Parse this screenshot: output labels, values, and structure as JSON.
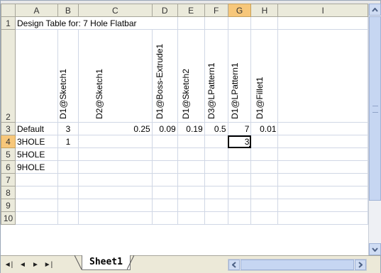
{
  "columns": [
    "A",
    "B",
    "C",
    "D",
    "E",
    "F",
    "G",
    "H",
    "I"
  ],
  "selected_column": "G",
  "rows": [
    {
      "num": "1",
      "cells": {
        "A": "Design Table for: 7 Hole Flatbar"
      }
    },
    {
      "num": "2",
      "headers": {
        "B": "D1@Sketch1",
        "C": "D2@Sketch1",
        "D": "D1@Boss-Extrude1",
        "E": "D1@Sketch2",
        "F": "D3@LPattern1",
        "G": "D1@LPattern1",
        "H": "D1@Fillet1"
      }
    },
    {
      "num": "3",
      "cells": {
        "A": "Default",
        "B": "3",
        "C": "0.25",
        "D": "0.09",
        "E": "0.19",
        "F": "0.5",
        "G": "7",
        "H": "0.01"
      }
    },
    {
      "num": "4",
      "cells": {
        "A": "3HOLE",
        "B": "1",
        "G": "3"
      }
    },
    {
      "num": "5",
      "cells": {
        "A": "5HOLE"
      }
    },
    {
      "num": "6",
      "cells": {
        "A": "9HOLE"
      }
    },
    {
      "num": "7",
      "cells": {}
    },
    {
      "num": "8",
      "cells": {}
    },
    {
      "num": "9",
      "cells": {}
    },
    {
      "num": "10",
      "cells": {}
    }
  ],
  "selected_row": "4",
  "sheet_tab": "Sheet1",
  "nav": {
    "first": "◄|",
    "prev": "◄",
    "next": "►",
    "last": "►|"
  }
}
